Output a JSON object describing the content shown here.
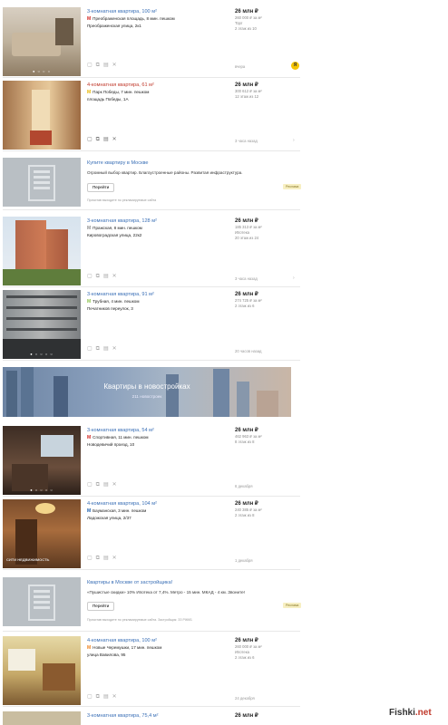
{
  "listings": [
    {
      "title": "3-комнатная квартира, 100 м²",
      "metro": "Преображенская площадь, 8 мин. пешком",
      "street": "Преображенская улица, 2к1",
      "price": "26 млн ₽",
      "ppm": "260 000 ₽ за м²",
      "extra1": "Торг",
      "extra2": "2 этаж из 10",
      "time": "вчера"
    },
    {
      "title": "4-комнатная квартира, 61 м²",
      "metro": "Парк Победы, 7 мин. пешком",
      "street": "площадь Победы, 1А",
      "price": "26 млн ₽",
      "ppm": "300 612 ₽ за м²",
      "extra1": "12 этаж из 12",
      "extra2": "",
      "time": "3 часа назад"
    },
    {
      "title": "3-комнатная квартира, 128 м²",
      "metro": "Пражская, 8 мин. пешком",
      "street": "Кировоградская улица, 22к2",
      "price": "26 млн ₽",
      "ppm": "185 313 ₽ за м²",
      "extra1": "Ипотека",
      "extra2": "20 этаж из 24",
      "time": "3 часа назад"
    },
    {
      "title": "3-комнатная квартира, 91 м²",
      "metro": "Трубная, 4 мин. пешком",
      "street": "Печатников переулок, 3",
      "price": "26 млн ₽",
      "ppm": "274 725 ₽ за м²",
      "extra1": "2 этаж из 6",
      "extra2": "",
      "time": "20 часов назад"
    },
    {
      "title": "3-комнатная квартира, 54 м²",
      "metro": "Спортивная, 11 мин. пешком",
      "street": "Новодевичий проезд, 10",
      "price": "26 млн ₽",
      "ppm": "462 963 ₽ за м²",
      "extra1": "8 этаж из 8",
      "extra2": "",
      "time": "6 декабря"
    },
    {
      "title": "4-комнатная квартира, 104 м²",
      "metro": "Бауманская, 3 мин. пешком",
      "street": "Ладожская улица, 2/37",
      "price": "26 млн ₽",
      "ppm": "240 385 ₽ за м²",
      "extra1": "2 этаж из 8",
      "extra2": "",
      "time": "1 декабря"
    },
    {
      "title": "4-комнатная квартира, 100 м²",
      "metro": "Новые Черемушки, 17 мин. пешком",
      "street": "улица Вавилова, 95",
      "price": "26 млн ₽",
      "ppm": "260 000 ₽ за м²",
      "extra1": "Ипотека",
      "extra2": "2 этаж из 6",
      "time": "24 декабря"
    },
    {
      "title": "3-комнатная квартира, 75,4 м²",
      "metro": "",
      "street": "",
      "price": "26 млн ₽",
      "ppm": "",
      "extra1": "",
      "extra2": "",
      "time": ""
    }
  ],
  "ads": [
    {
      "title": "Купите квартиру в Москве",
      "desc": "Огромный выбор квартир. Благоустроенные районы. Развитая инфраструктура.",
      "button": "Перейти",
      "label": "Реклама",
      "disclaimer": "Прочитав выходите по рекламируемые сайта"
    },
    {
      "title": "Квартиры в Москве от застройщика!",
      "desc": "«Пушистые скидки» 10% Ипотека от 7,4%. Метро - 15 мин. МКАД - 4 км. Звоните!",
      "button": "Перейти",
      "label": "Реклама",
      "disclaimer": "Прочитав выходите по рекламируемые сайта. Застройщик: ЗЗ РЖКБ"
    }
  ],
  "banner": {
    "title": "Квартиры в новостройках",
    "subtitle": "211 новостроек"
  },
  "watermark": {
    "left": "Fishki",
    "right": ".net"
  },
  "icons": {
    "metro": "metro-icon",
    "bookmark": "bookmark-icon",
    "compare": "compare-icon",
    "note": "note-icon",
    "hide": "hide-icon",
    "more": "more-arrow-icon"
  }
}
